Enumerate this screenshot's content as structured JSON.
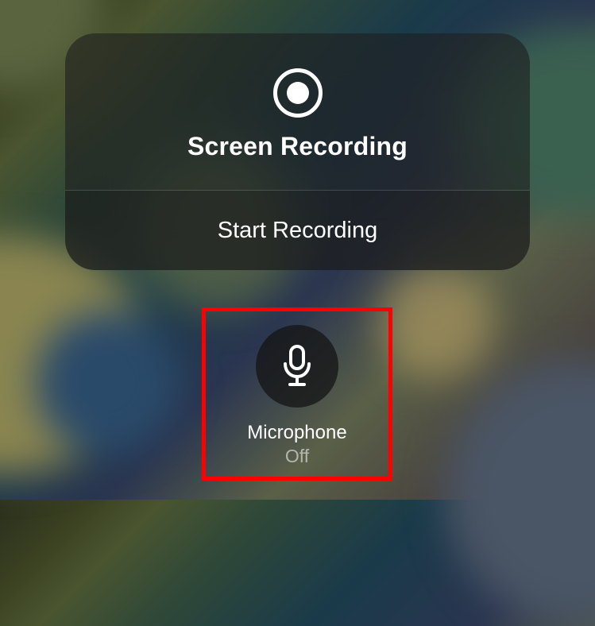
{
  "panel": {
    "title": "Screen Recording",
    "action_label": "Start Recording"
  },
  "microphone": {
    "label": "Microphone",
    "status": "Off"
  },
  "colors": {
    "highlight": "#ff0000",
    "text_primary": "#ffffff"
  }
}
